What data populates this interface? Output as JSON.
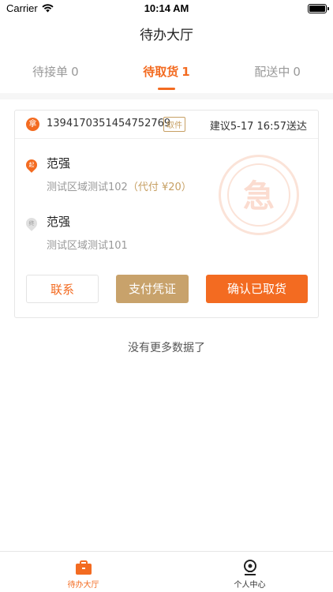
{
  "status_bar": {
    "carrier": "Carrier",
    "time": "10:14 AM"
  },
  "nav": {
    "title": "待办大厅"
  },
  "tabs": [
    {
      "label": "待接单",
      "count": "0",
      "active": false
    },
    {
      "label": "待取货",
      "count": "1",
      "active": true
    },
    {
      "label": "配送中",
      "count": "0",
      "active": false
    }
  ],
  "order": {
    "grab_badge": "拿",
    "order_no": "1394170351454752769",
    "pickup_tag": "取件",
    "deliver_tip": "建议5-17 16:57送达",
    "start": {
      "pin_text": "起",
      "name": "范强",
      "address": "测试区域测试102",
      "payment": "（代付 ¥20）"
    },
    "end": {
      "pin_text": "终",
      "name": "范强",
      "address": "测试区域测试101"
    },
    "urgent_stamp": "急",
    "buttons": {
      "contact": "联系",
      "payment_proof": "支付凭证",
      "confirm_pickup": "确认已取货"
    }
  },
  "list_footer": "没有更多数据了",
  "tabbar": [
    {
      "label": "待办大厅",
      "icon": "briefcase-icon",
      "active": true
    },
    {
      "label": "个人中心",
      "icon": "user-icon",
      "active": false
    }
  ],
  "colors": {
    "accent": "#f36b21",
    "gold": "#c8a26b"
  }
}
